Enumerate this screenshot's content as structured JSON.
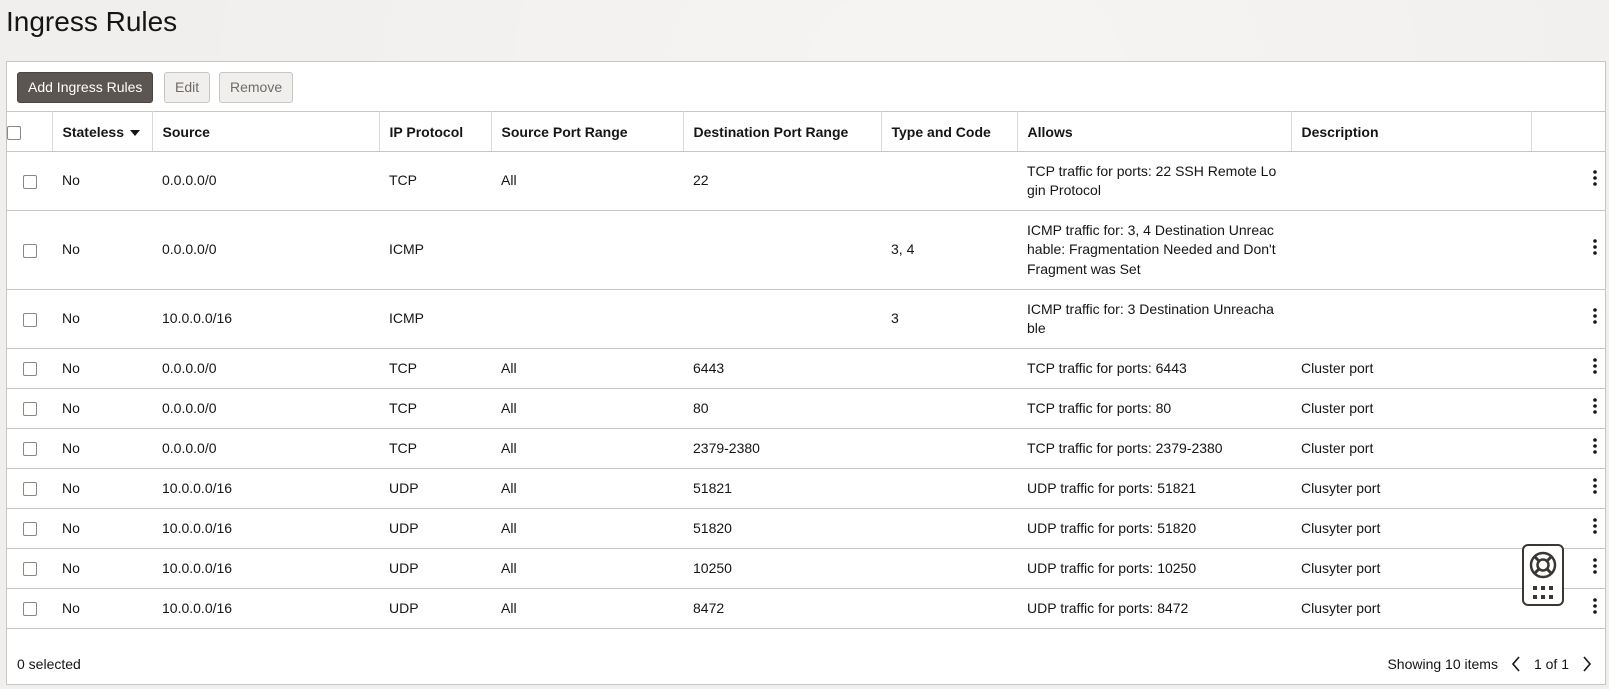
{
  "page": {
    "title": "Ingress Rules"
  },
  "toolbar": {
    "add_label": "Add Ingress Rules",
    "edit_label": "Edit",
    "remove_label": "Remove"
  },
  "table": {
    "columns": [
      "Stateless",
      "Source",
      "IP Protocol",
      "Source Port Range",
      "Destination Port Range",
      "Type and Code",
      "Allows",
      "Description"
    ],
    "sorted_column": "Stateless",
    "rows": [
      {
        "stateless": "No",
        "source": "0.0.0.0/0",
        "protocol": "TCP",
        "source_port": "All",
        "dest_port": "22",
        "type_code": "",
        "allows": "TCP traffic for ports: 22 SSH Remote Login Protocol",
        "description": ""
      },
      {
        "stateless": "No",
        "source": "0.0.0.0/0",
        "protocol": "ICMP",
        "source_port": "",
        "dest_port": "",
        "type_code": "3, 4",
        "allows": "ICMP traffic for: 3, 4 Destination Unreachable: Fragmentation Needed and Don't Fragment was Set",
        "description": ""
      },
      {
        "stateless": "No",
        "source": "10.0.0.0/16",
        "protocol": "ICMP",
        "source_port": "",
        "dest_port": "",
        "type_code": "3",
        "allows": "ICMP traffic for: 3 Destination Unreachable",
        "description": ""
      },
      {
        "stateless": "No",
        "source": "0.0.0.0/0",
        "protocol": "TCP",
        "source_port": "All",
        "dest_port": "6443",
        "type_code": "",
        "allows": "TCP traffic for ports: 6443",
        "description": "Cluster port"
      },
      {
        "stateless": "No",
        "source": "0.0.0.0/0",
        "protocol": "TCP",
        "source_port": "All",
        "dest_port": "80",
        "type_code": "",
        "allows": "TCP traffic for ports: 80",
        "description": "Cluster port"
      },
      {
        "stateless": "No",
        "source": "0.0.0.0/0",
        "protocol": "TCP",
        "source_port": "All",
        "dest_port": "2379-2380",
        "type_code": "",
        "allows": "TCP traffic for ports: 2379-2380",
        "description": "Cluster port"
      },
      {
        "stateless": "No",
        "source": "10.0.0.0/16",
        "protocol": "UDP",
        "source_port": "All",
        "dest_port": "51821",
        "type_code": "",
        "allows": "UDP traffic for ports: 51821",
        "description": "Clusyter port"
      },
      {
        "stateless": "No",
        "source": "10.0.0.0/16",
        "protocol": "UDP",
        "source_port": "All",
        "dest_port": "51820",
        "type_code": "",
        "allows": "UDP traffic for ports: 51820",
        "description": "Clusyter port"
      },
      {
        "stateless": "No",
        "source": "10.0.0.0/16",
        "protocol": "UDP",
        "source_port": "All",
        "dest_port": "10250",
        "type_code": "",
        "allows": "UDP traffic for ports: 10250",
        "description": "Clusyter port"
      },
      {
        "stateless": "No",
        "source": "10.0.0.0/16",
        "protocol": "UDP",
        "source_port": "All",
        "dest_port": "8472",
        "type_code": "",
        "allows": "UDP traffic for ports: 8472",
        "description": "Clusyter port"
      }
    ]
  },
  "footer": {
    "selected_text": "0 selected",
    "showing_text": "Showing 10 items",
    "page_text": "1 of 1"
  },
  "icons": {
    "sort": "caret-down-icon",
    "row_actions": "kebab-menu-icon",
    "prev": "chevron-left-icon",
    "next": "chevron-right-icon",
    "help": "lifebuoy-icon",
    "apps": "grid-icon"
  }
}
